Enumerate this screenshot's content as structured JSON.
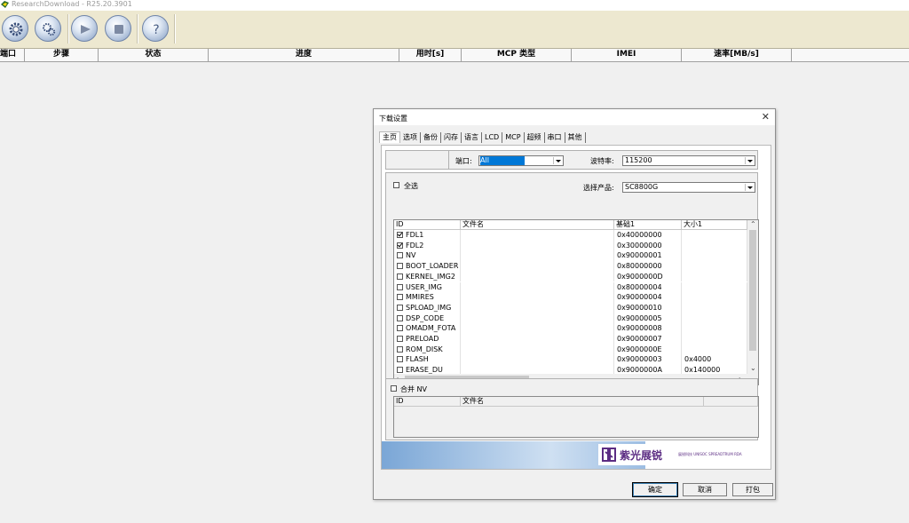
{
  "app": {
    "title": "ResearchDownload - R25.20.3901"
  },
  "toolbar": {
    "buttons": [
      {
        "name": "load-packet",
        "icon": "gear-icon"
      },
      {
        "name": "settings",
        "icon": "gears-icon"
      },
      {
        "name": "start",
        "icon": "play-icon"
      },
      {
        "name": "stop",
        "icon": "stop-icon"
      },
      {
        "name": "help",
        "icon": "question-icon"
      }
    ]
  },
  "list": {
    "columns": [
      "端口",
      "步骤",
      "状态",
      "进度",
      "用时[s]",
      "MCP 类型",
      "IMEI",
      "速率[MB/s]"
    ]
  },
  "dialog": {
    "title": "下载设置",
    "tabs": [
      "主页",
      "选项",
      "备份",
      "闪存",
      "语言",
      "LCD",
      "MCP",
      "超频",
      "串口",
      "其他"
    ],
    "active_tab": "主页",
    "port_label": "端口:",
    "port_value": "All",
    "baud_label": "波特率:",
    "baud_value": "115200",
    "select_all_label": "全选",
    "product_label": "选择产品:",
    "product_value": "SC8800G",
    "file_table": {
      "columns": [
        "ID",
        "文件名",
        "基础1",
        "大小1"
      ],
      "rows": [
        {
          "id": "FDL1",
          "checked": true,
          "file": "",
          "base": "0x40000000",
          "size": ""
        },
        {
          "id": "FDL2",
          "checked": true,
          "file": "",
          "base": "0x30000000",
          "size": ""
        },
        {
          "id": "NV",
          "checked": false,
          "file": "",
          "base": "0x90000001",
          "size": ""
        },
        {
          "id": "BOOT_LOADER",
          "checked": false,
          "file": "",
          "base": "0x80000000",
          "size": ""
        },
        {
          "id": "KERNEL_IMG2",
          "checked": false,
          "file": "",
          "base": "0x9000000D",
          "size": ""
        },
        {
          "id": "USER_IMG",
          "checked": false,
          "file": "",
          "base": "0x80000004",
          "size": ""
        },
        {
          "id": "MMIRES",
          "checked": false,
          "file": "",
          "base": "0x90000004",
          "size": ""
        },
        {
          "id": "SPLOAD_IMG",
          "checked": false,
          "file": "",
          "base": "0x90000010",
          "size": ""
        },
        {
          "id": "DSP_CODE",
          "checked": false,
          "file": "",
          "base": "0x90000005",
          "size": ""
        },
        {
          "id": "OMADM_FOTA",
          "checked": false,
          "file": "",
          "base": "0x90000008",
          "size": ""
        },
        {
          "id": "PRELOAD",
          "checked": false,
          "file": "",
          "base": "0x90000007",
          "size": ""
        },
        {
          "id": "ROM_DISK",
          "checked": false,
          "file": "",
          "base": "0x9000000E",
          "size": ""
        },
        {
          "id": "FLASH",
          "checked": false,
          "file": "",
          "base": "0x90000003",
          "size": "0x4000"
        },
        {
          "id": "ERASE_DU",
          "checked": false,
          "file": "",
          "base": "0x9000000A",
          "size": "0x140000"
        }
      ]
    },
    "merge_nv_label": "合并 NV",
    "nv_table": {
      "columns": [
        "ID",
        "文件名"
      ]
    },
    "logo_text": "紫光展锐",
    "logo_sub": "展锐科技 UNISOC SPREADTRUM RDA",
    "buttons": {
      "ok": "确定",
      "cancel": "取消",
      "pack": "打包"
    },
    "close_glyph": "✕"
  },
  "colors": {
    "toolbar_bg": "#ede8d0",
    "combo_selected": "#0078d7",
    "logo_purple": "#5b2c83"
  }
}
